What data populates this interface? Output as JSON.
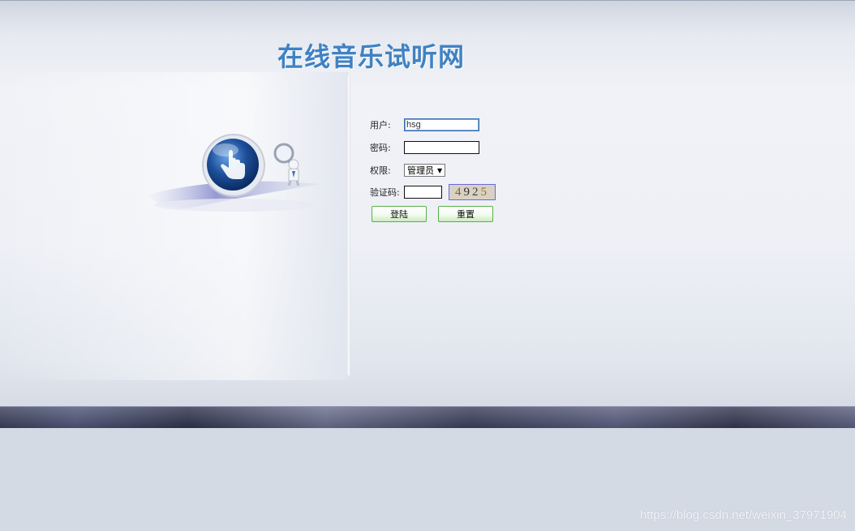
{
  "site_title": "在线音乐试听网",
  "form": {
    "username_label": "用户:",
    "username_value": "hsg",
    "password_label": "密码:",
    "password_value": "",
    "role_label": "权限:",
    "role_selected": "管理员",
    "captcha_label": "验证码:",
    "captcha_value": "",
    "captcha_digits": [
      "4",
      "9",
      "2",
      "5"
    ],
    "login_button": "登陆",
    "reset_button": "重置"
  },
  "watermark": "https://blog.csdn.net/weixin_37971904",
  "colors": {
    "title": "#3f82c4",
    "footer_bar": "#3a3f5a",
    "button_border": "#5ab04a",
    "captcha_border": "#6a6ad8"
  },
  "icons": [
    "hand-pointer-globe-icon",
    "magnifier-figure-icon",
    "dropdown-arrow-icon"
  ]
}
